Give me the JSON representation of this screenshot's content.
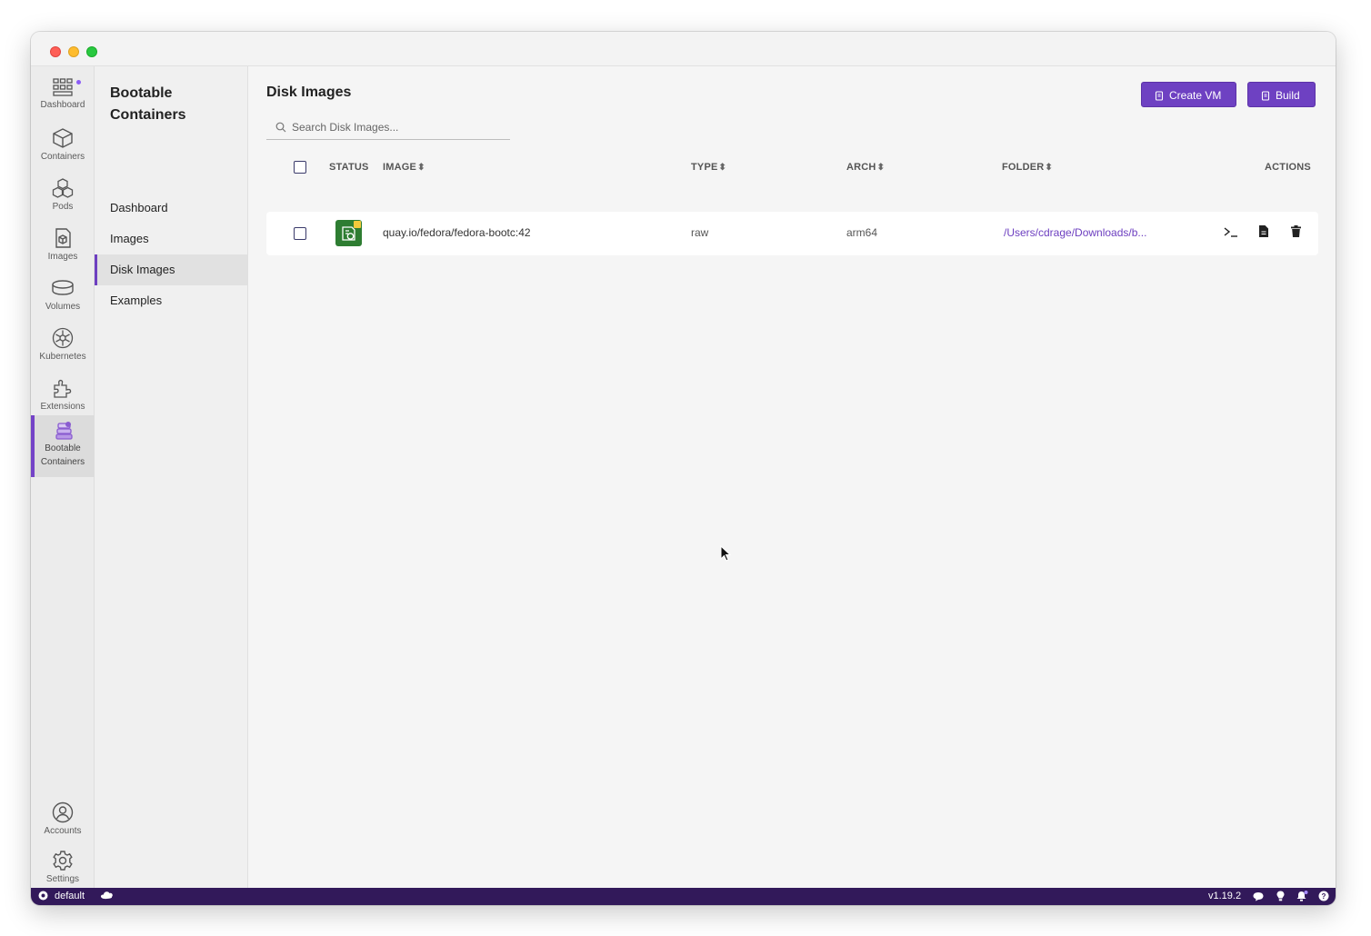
{
  "navbar": {
    "items": [
      {
        "label": "Dashboard",
        "icon": "dashboard-icon"
      },
      {
        "label": "Containers",
        "icon": "containers-icon"
      },
      {
        "label": "Pods",
        "icon": "pods-icon"
      },
      {
        "label": "Images",
        "icon": "images-icon"
      },
      {
        "label": "Volumes",
        "icon": "volumes-icon"
      },
      {
        "label": "Kubernetes",
        "icon": "kubernetes-icon"
      },
      {
        "label": "Extensions",
        "icon": "extensions-icon"
      },
      {
        "label": "Bootable\nContainers",
        "icon": "bootable-containers-icon",
        "active": true
      }
    ],
    "bottom": [
      {
        "label": "Accounts",
        "icon": "accounts-icon"
      },
      {
        "label": "Settings",
        "icon": "settings-icon"
      }
    ]
  },
  "subnav": {
    "title": "Bootable Containers",
    "items": [
      {
        "label": "Dashboard"
      },
      {
        "label": "Images"
      },
      {
        "label": "Disk Images",
        "active": true
      },
      {
        "label": "Examples"
      }
    ]
  },
  "main": {
    "title": "Disk Images",
    "buttons": {
      "create_vm": "Create VM",
      "build": "Build"
    },
    "search": {
      "placeholder": "Search Disk Images..."
    },
    "table": {
      "columns": {
        "status": "STATUS",
        "image": "IMAGE",
        "type": "TYPE",
        "arch": "ARCH",
        "folder": "FOLDER",
        "actions": "ACTIONS"
      },
      "rows": [
        {
          "image": "quay.io/fedora/fedora-bootc:42",
          "type": "raw",
          "arch": "arm64",
          "folder": "/Users/cdrage/Downloads/b..."
        }
      ]
    }
  },
  "statusbar": {
    "context": "default",
    "version": "v1.19.2"
  },
  "colors": {
    "accent": "#6e41c2",
    "statusbar": "#32195a",
    "status_icon": "#2e7d32"
  }
}
